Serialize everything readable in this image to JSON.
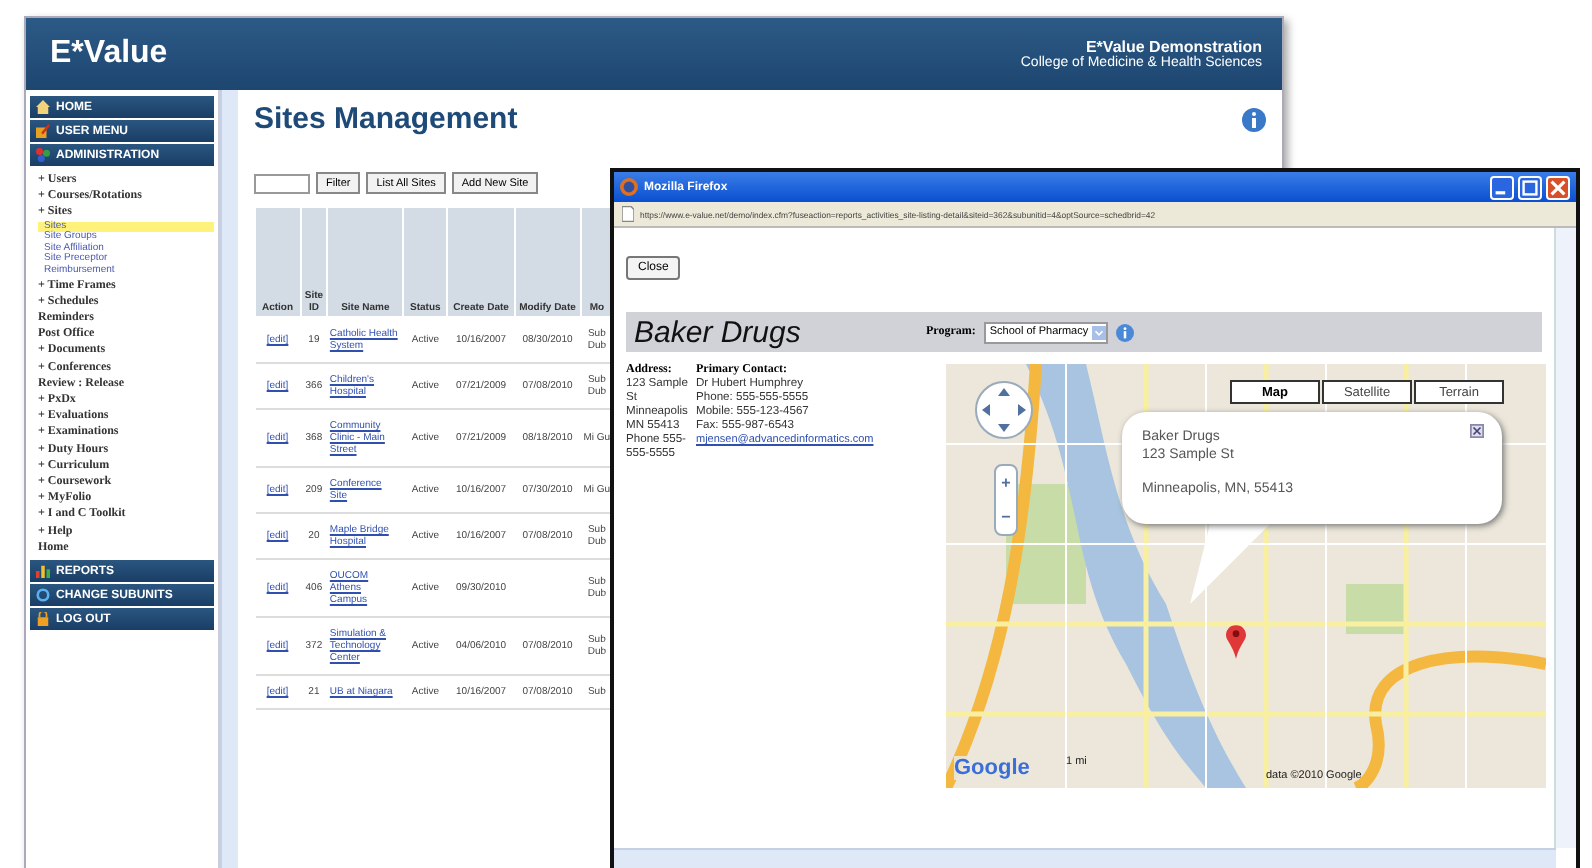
{
  "header": {
    "logo": "E*Value",
    "title": "E*Value Demonstration",
    "subtitle": "College of Medicine & Health Sciences"
  },
  "sidebar": {
    "top_sections": [
      {
        "label": "HOME",
        "kind": "home"
      },
      {
        "label": "USER MENU",
        "kind": "user"
      },
      {
        "label": "ADMINISTRATION",
        "kind": "admin"
      }
    ],
    "tree": [
      {
        "marker": "+",
        "label": "Users"
      },
      {
        "marker": "+",
        "label": "Courses/Rotations"
      },
      {
        "marker": "+",
        "label": "Sites",
        "children": [
          {
            "label": "Sites",
            "selected": true
          },
          {
            "label": "Site Groups",
            "selected": false
          },
          {
            "label": "Site Affiliation",
            "selected": false
          },
          {
            "label": "Site Preceptor",
            "selected": false
          },
          {
            "label": "Reimbursement",
            "selected": false
          }
        ]
      },
      {
        "marker": "+",
        "label": "Time Frames"
      },
      {
        "marker": "+",
        "label": "Schedules"
      },
      {
        "label": "Reminders"
      },
      {
        "label": "Post Office"
      },
      {
        "marker": "+",
        "label": "Documents"
      },
      {
        "marker": "+",
        "label": "Conferences"
      },
      {
        "label": "Review : Release"
      },
      {
        "marker": "+",
        "label": "PxDx"
      },
      {
        "marker": "+",
        "label": "Evaluations"
      },
      {
        "marker": "+",
        "label": "Examinations"
      },
      {
        "marker": "+",
        "label": "Duty Hours"
      },
      {
        "marker": "+",
        "label": "Curriculum"
      },
      {
        "marker": "+",
        "label": "Coursework"
      },
      {
        "marker": "+",
        "label": "MyFolio"
      },
      {
        "marker": "+",
        "label": "I and C Toolkit"
      },
      {
        "marker": "+",
        "label": "Help"
      },
      {
        "label": "Home"
      }
    ],
    "bottom_sections": [
      {
        "label": "REPORTS",
        "kind": "reports"
      },
      {
        "label": "CHANGE SUBUNITS",
        "kind": "subunits"
      },
      {
        "label": "LOG OUT",
        "kind": "logout"
      }
    ]
  },
  "page": {
    "title": "Sites Management",
    "buttons": [
      "Filter",
      "List All Sites",
      "Add New Site"
    ],
    "table": {
      "columns": [
        "Action",
        "Site ID",
        "Site Name",
        "Status",
        "Create Date",
        "Modify Date",
        "Mo"
      ],
      "rows": [
        {
          "action": "[edit]",
          "site_id": "19",
          "site_name": "Catholic Health System",
          "status": "Active",
          "create_date": "10/16/2007",
          "modify_date": "08/30/2010",
          "column_7": "Sub Dub"
        },
        {
          "action": "[edit]",
          "site_id": "366",
          "site_name": "Children's Hospital",
          "status": "Active",
          "create_date": "07/21/2009",
          "modify_date": "07/08/2010",
          "column_7": "Sub Dub"
        },
        {
          "action": "[edit]",
          "site_id": "368",
          "site_name": "Community Clinic - Main Street",
          "status": "Active",
          "create_date": "07/21/2009",
          "modify_date": "08/18/2010",
          "column_7": "Mi Gu"
        },
        {
          "action": "[edit]",
          "site_id": "209",
          "site_name": "Conference Site",
          "status": "Active",
          "create_date": "10/16/2007",
          "modify_date": "07/30/2010",
          "column_7": "Mi Gu"
        },
        {
          "action": "[edit]",
          "site_id": "20",
          "site_name": "Maple Bridge Hospital",
          "status": "Active",
          "create_date": "10/16/2007",
          "modify_date": "07/08/2010",
          "column_7": "Sub Dub"
        },
        {
          "action": "[edit]",
          "site_id": "406",
          "site_name": "OUCOM Athens Campus",
          "status": "Active",
          "create_date": "09/30/2010",
          "column_7": "Sub Dub"
        },
        {
          "action": "[edit]",
          "site_id": "372",
          "site_name": "Simulation & Technology Center",
          "status": "Active",
          "create_date": "04/06/2010",
          "modify_date": "07/08/2010",
          "column_7": "Sub Dub"
        },
        {
          "action": "[edit]",
          "site_id": "21",
          "site_name": "UB at Niagara",
          "status": "Active",
          "create_date": "10/16/2007",
          "modify_date": "07/08/2010",
          "column_7": "Sub"
        }
      ]
    }
  },
  "popup": {
    "window_title": "Mozilla Firefox",
    "url": "https://www.e-value.net/demo/index.cfm?fuseaction=reports_activities_site-listing-detail&siteid=362&subunitid=4&optSource=schedbrid=42",
    "close_button": "Close",
    "site_name": "Baker Drugs",
    "program_label": "Program:",
    "program_value": "School of Pharmacy",
    "address": {
      "heading": "Address:",
      "lines": [
        "123 Sample St",
        "Minneapolis MN 55413",
        "Phone 555-555-5555"
      ]
    },
    "contact": {
      "heading": "Primary Contact:",
      "lines": [
        "Dr Hubert Humphrey",
        "Phone: 555-555-5555",
        "Mobile: 555-123-4567",
        "Fax: 555-987-6543"
      ],
      "email": "mjensen@advancedinformatics.com"
    },
    "map": {
      "map_types": [
        {
          "label": "Map",
          "selected": true
        },
        {
          "label": "Satellite",
          "selected": false
        },
        {
          "label": "Terrain",
          "selected": false
        }
      ],
      "zoom_in": "+",
      "zoom_out": "−",
      "info_window": {
        "lines": [
          "Baker Drugs",
          "123 Sample St"
        ],
        "city_line": "Minneapolis, MN, 55413"
      },
      "logo": "Google",
      "scale": "1 mi",
      "attribution": "data ©2010 Google"
    }
  }
}
